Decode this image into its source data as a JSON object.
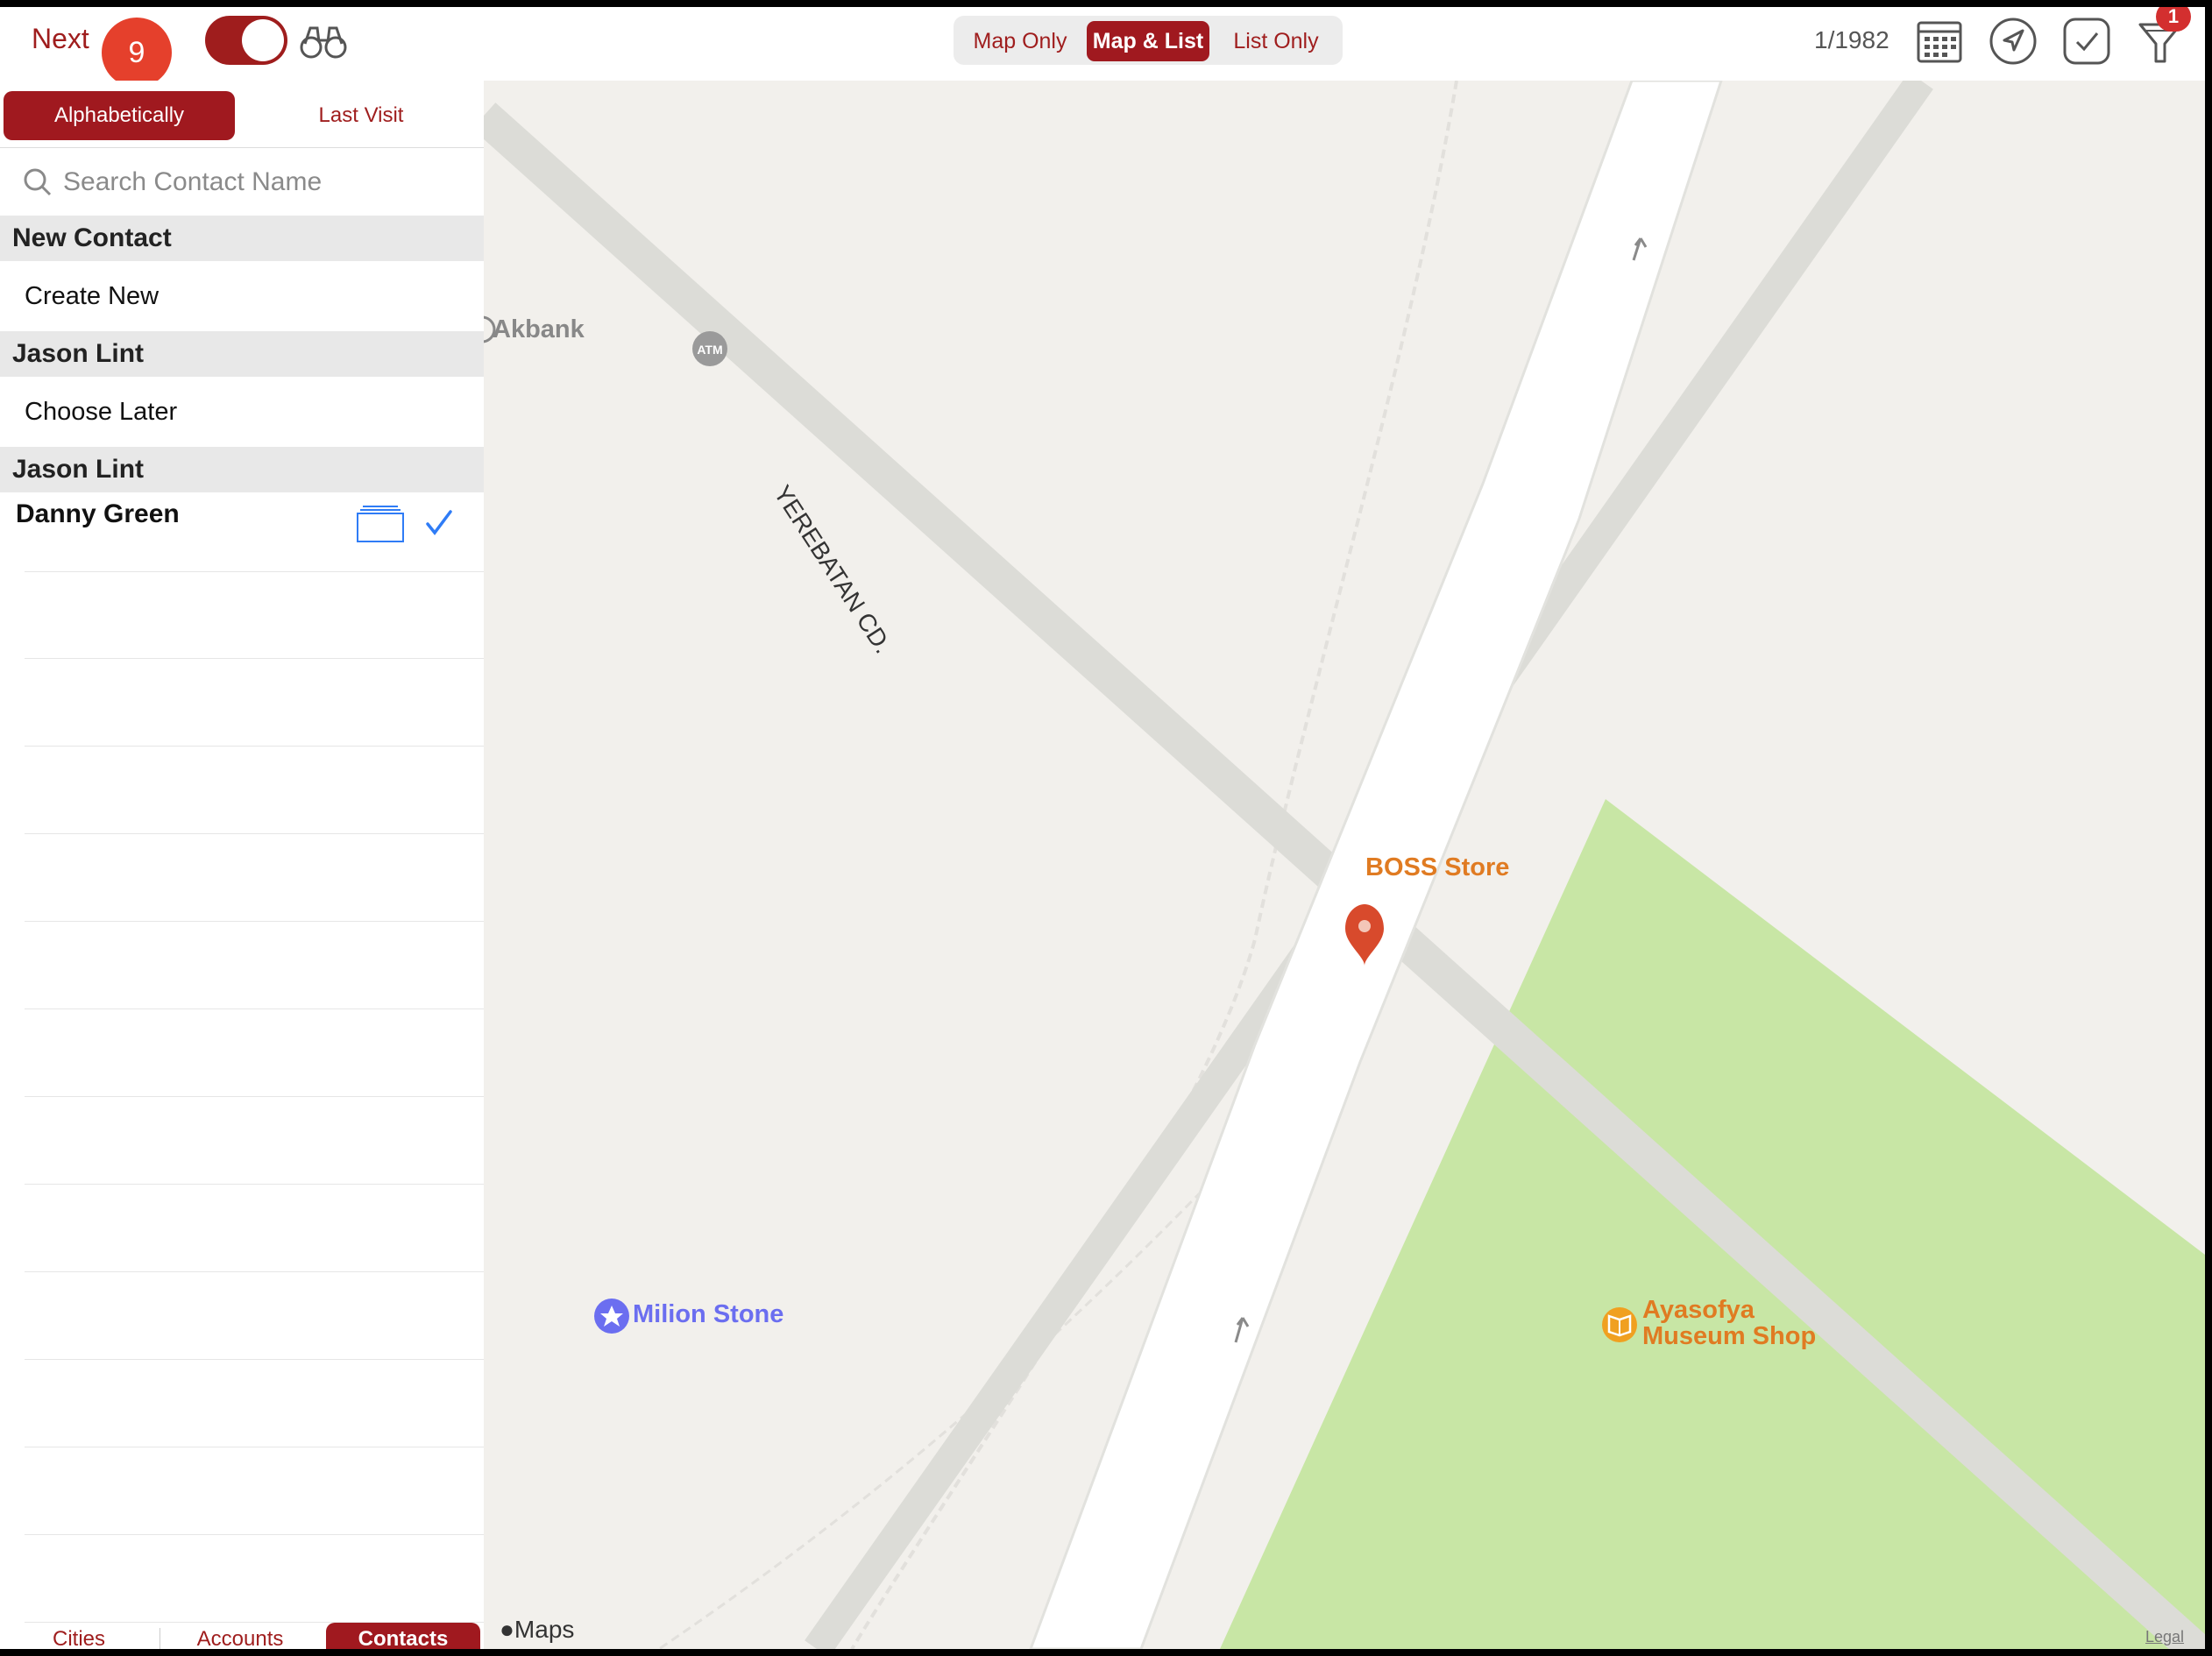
{
  "topbar": {
    "next_label": "Next",
    "next_badge": "9",
    "view_options": [
      "Map Only",
      "Map & List",
      "List Only"
    ],
    "active_view": "Map & List",
    "counter": "1/1982",
    "filter_badge": "1",
    "icons": [
      "binoculars-icon",
      "calendar-icon",
      "location-arrow-icon",
      "checkmark-icon",
      "filter-icon"
    ]
  },
  "sidebar": {
    "sort_tabs": [
      "Alphabetically",
      "Last Visit"
    ],
    "active_sort": "Alphabetically",
    "search_placeholder": "Search Contact Name",
    "sections": [
      {
        "header": "New Contact",
        "item": "Create New"
      },
      {
        "header": "Jason Lint",
        "item": "Choose Later"
      },
      {
        "header": "Jason Lint"
      }
    ],
    "contact": {
      "name": "Danny Green",
      "checked": true
    },
    "bottom_tabs": [
      "Cities",
      "Accounts",
      "Contacts"
    ],
    "active_bottom_tab": "Contacts"
  },
  "map": {
    "street": "YEREBATAN CD.",
    "pois": {
      "akbank": "Akbank",
      "atm": "ATM",
      "boss": "BOSS Store",
      "milion": "Milion Stone",
      "ayasofya_1": "Ayasofya",
      "ayasofya_2": "Museum Shop"
    },
    "brand": "Maps",
    "legal": "Legal"
  },
  "colors": {
    "accent": "#a0191f",
    "badge": "#e5402c",
    "park": "#c8e6a5",
    "road": "#ffffff",
    "land": "#f2f0ec",
    "poi_orange": "#e07b22",
    "poi_purple": "#6b6ef0",
    "check_blue": "#2f7cf6"
  }
}
